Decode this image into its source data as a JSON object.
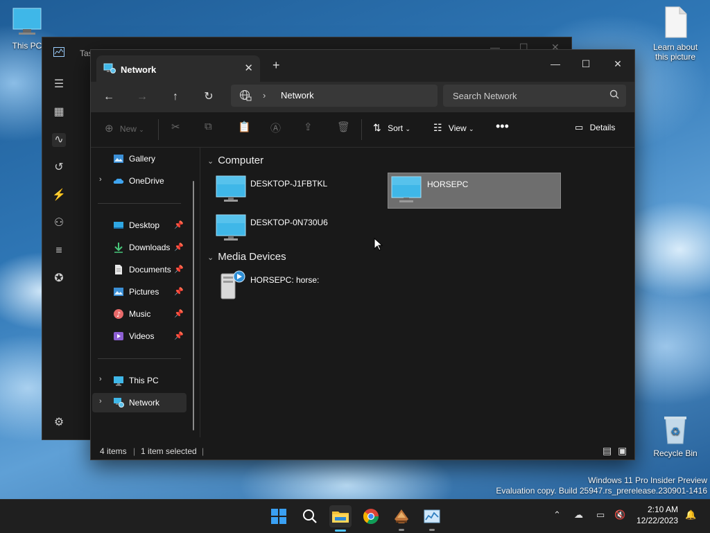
{
  "desktop": {
    "icons": [
      {
        "label": "This PC",
        "icon": "monitor-icon"
      },
      {
        "label": "Learn about this picture",
        "icon": "document-icon"
      },
      {
        "label": "Recycle Bin",
        "icon": "recycle-bin-icon"
      }
    ],
    "watermark": {
      "line1": "Windows 11 Pro Insider Preview",
      "line2": "Evaluation copy. Build 25947.rs_prerelease.230901-1416"
    }
  },
  "background_window": {
    "title": "Tas"
  },
  "explorer": {
    "tab_title": "Network",
    "address": {
      "location": "Network"
    },
    "search": {
      "placeholder": "Search Network"
    },
    "commands": {
      "new": "New",
      "sort": "Sort",
      "view": "View",
      "details": "Details"
    },
    "nav": {
      "items": [
        {
          "label": "Gallery"
        },
        {
          "label": "OneDrive"
        },
        {
          "label": "Desktop"
        },
        {
          "label": "Downloads"
        },
        {
          "label": "Documents"
        },
        {
          "label": "Pictures"
        },
        {
          "label": "Music"
        },
        {
          "label": "Videos"
        },
        {
          "label": "This PC"
        },
        {
          "label": "Network"
        }
      ]
    },
    "groups": [
      {
        "name": "Computer",
        "items": [
          "DESKTOP-J1FBTKL",
          "HORSEPC",
          "DESKTOP-0N730U6"
        ]
      },
      {
        "name": "Media Devices",
        "items": [
          "HORSEPC: horse:"
        ]
      }
    ],
    "status": {
      "count": "4 items",
      "selected": "1 item selected"
    }
  },
  "taskbar": {
    "clock": {
      "time": "2:10 AM",
      "date": "12/22/2023"
    }
  },
  "colors": {
    "accent": "#4cc2ff",
    "window_bg": "#191919",
    "selected_tile": "#6e6e6e"
  }
}
